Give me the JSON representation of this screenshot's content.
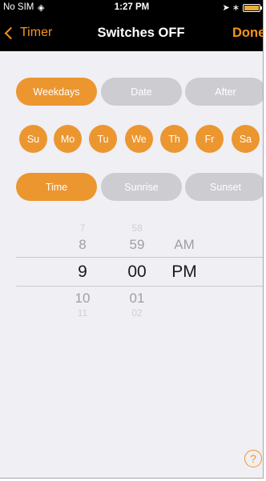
{
  "status_bar": {
    "carrier": "No SIM",
    "time": "1:27 PM",
    "battery_color": "#e8ad3c"
  },
  "nav": {
    "back_label": "Timer",
    "title": "Switches OFF",
    "done_label": "Done"
  },
  "accent_color": "#ec9630",
  "schedule_tabs": [
    {
      "label": "Weekdays",
      "selected": true
    },
    {
      "label": "Date",
      "selected": false
    },
    {
      "label": "After",
      "selected": false
    }
  ],
  "days": [
    {
      "label": "Su",
      "selected": true
    },
    {
      "label": "Mo",
      "selected": true
    },
    {
      "label": "Tu",
      "selected": true
    },
    {
      "label": "We",
      "selected": true
    },
    {
      "label": "Th",
      "selected": true
    },
    {
      "label": "Fr",
      "selected": true
    },
    {
      "label": "Sa",
      "selected": true
    }
  ],
  "trigger_tabs": [
    {
      "label": "Time",
      "selected": true
    },
    {
      "label": "Sunrise",
      "selected": false
    },
    {
      "label": "Sunset",
      "selected": false
    }
  ],
  "time_picker": {
    "hours": [
      "7",
      "8",
      "9",
      "10",
      "11"
    ],
    "minutes": [
      "58",
      "59",
      "00",
      "01",
      "02"
    ],
    "ampm": [
      "AM",
      "PM"
    ],
    "selected": {
      "hour": "9",
      "minute": "00",
      "ampm": "PM"
    }
  },
  "help_label": "?"
}
